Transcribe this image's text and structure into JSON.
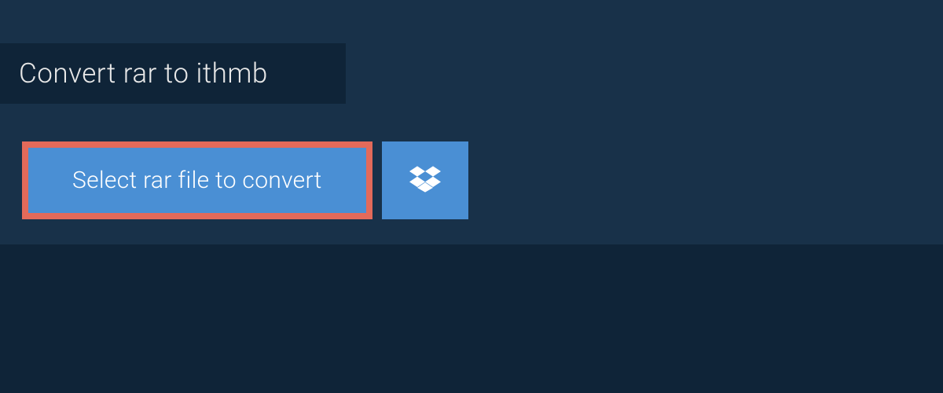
{
  "header": {
    "title": "Convert rar to ithmb"
  },
  "actions": {
    "select_file_label": "Select rar file to convert",
    "dropbox_icon": "dropbox-icon"
  },
  "colors": {
    "background_dark": "#0f2438",
    "background_panel": "#183149",
    "button_primary": "#4a8fd4",
    "button_highlight_border": "#e36a5a",
    "text_light": "#e8e8e8"
  }
}
